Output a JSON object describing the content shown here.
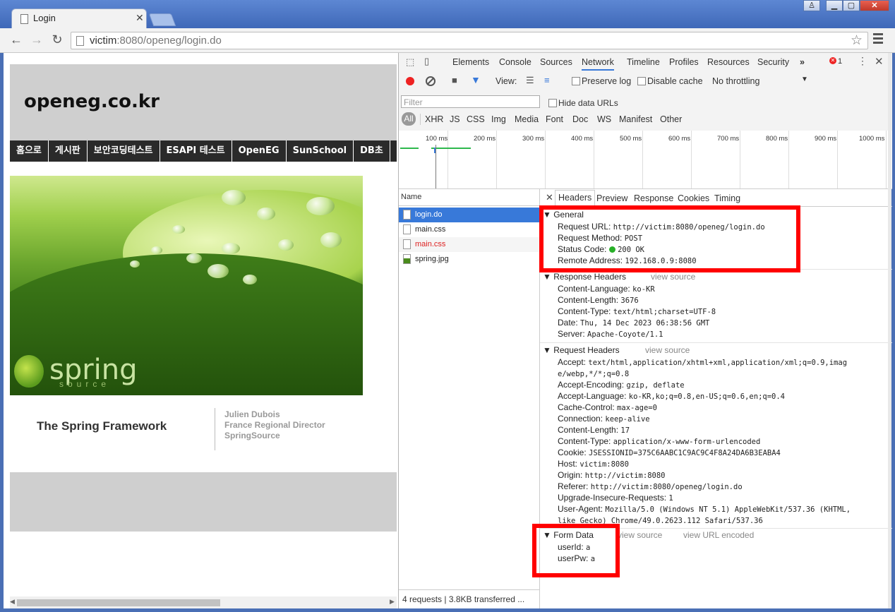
{
  "browser": {
    "tab_title": "Login",
    "url_host": "victim",
    "url_rest": ":8080/openeg/login.do"
  },
  "page": {
    "site_title": "openeg.co.kr",
    "nav": [
      "홈으로",
      "게시판",
      "보안코딩테스트",
      "ESAPI 테스트",
      "OpenEG",
      "SunSchool",
      "DB초"
    ],
    "banner": {
      "logo_word": "spring",
      "logo_sub": "source"
    },
    "credits": {
      "title": "The Spring Framework",
      "name": "Julien Dubois",
      "role": "France Regional Director",
      "org": "SpringSource"
    }
  },
  "devtools": {
    "tabs": [
      "Elements",
      "Console",
      "Sources",
      "Network",
      "Timeline",
      "Profiles",
      "Resources",
      "Security"
    ],
    "more": "»",
    "error_count": "1",
    "toolbar": {
      "view_label": "View:",
      "preserve_log": "Preserve log",
      "disable_cache": "Disable cache",
      "throttling": "No throttling"
    },
    "filter_placeholder": "Filter",
    "hide_data_urls": "Hide data URLs",
    "filter_types": [
      "All",
      "XHR",
      "JS",
      "CSS",
      "Img",
      "Media",
      "Font",
      "Doc",
      "WS",
      "Manifest",
      "Other"
    ],
    "timeline_ticks": [
      "100 ms",
      "200 ms",
      "300 ms",
      "400 ms",
      "500 ms",
      "600 ms",
      "700 ms",
      "800 ms",
      "900 ms",
      "1000 ms"
    ],
    "name_header": "Name",
    "requests": [
      {
        "name": "login.do",
        "selected": true,
        "error": false
      },
      {
        "name": "main.css",
        "selected": false,
        "error": false
      },
      {
        "name": "main.css",
        "selected": false,
        "error": true
      },
      {
        "name": "spring.jpg",
        "selected": false,
        "error": false
      }
    ],
    "summary": "4 requests  |  3.8KB transferred  ...",
    "detail_tabs": [
      "Headers",
      "Preview",
      "Response",
      "Cookies",
      "Timing"
    ],
    "general": {
      "title": "General",
      "rows": [
        {
          "k": "Request URL:",
          "v": "http://victim:8080/openeg/login.do"
        },
        {
          "k": "Request Method:",
          "v": "POST"
        },
        {
          "k": "Status Code:",
          "v": "200 OK"
        },
        {
          "k": "Remote Address:",
          "v": "192.168.0.9:8080"
        }
      ]
    },
    "response_headers": {
      "title": "Response Headers",
      "view_source": "view source",
      "rows": [
        {
          "k": "Content-Language:",
          "v": "ko-KR"
        },
        {
          "k": "Content-Length:",
          "v": "3676"
        },
        {
          "k": "Content-Type:",
          "v": "text/html;charset=UTF-8"
        },
        {
          "k": "Date:",
          "v": "Thu, 14 Dec 2023 06:38:56 GMT"
        },
        {
          "k": "Server:",
          "v": "Apache-Coyote/1.1"
        }
      ]
    },
    "request_headers": {
      "title": "Request Headers",
      "view_source": "view source",
      "rows": [
        {
          "k": "Accept:",
          "v": "text/html,application/xhtml+xml,application/xml;q=0.9,imag"
        },
        {
          "k": "",
          "v": "e/webp,*/*;q=0.8"
        },
        {
          "k": "Accept-Encoding:",
          "v": "gzip, deflate"
        },
        {
          "k": "Accept-Language:",
          "v": "ko-KR,ko;q=0.8,en-US;q=0.6,en;q=0.4"
        },
        {
          "k": "Cache-Control:",
          "v": "max-age=0"
        },
        {
          "k": "Connection:",
          "v": "keep-alive"
        },
        {
          "k": "Content-Length:",
          "v": "17"
        },
        {
          "k": "Content-Type:",
          "v": "application/x-www-form-urlencoded"
        },
        {
          "k": "Cookie:",
          "v": "JSESSIONID=375C6AABC1C9AC9C4F8A24DA6B3EABA4"
        },
        {
          "k": "Host:",
          "v": "victim:8080"
        },
        {
          "k": "Origin:",
          "v": "http://victim:8080"
        },
        {
          "k": "Referer:",
          "v": "http://victim:8080/openeg/login.do"
        },
        {
          "k": "Upgrade-Insecure-Requests:",
          "v": "1"
        },
        {
          "k": "User-Agent:",
          "v": "Mozilla/5.0 (Windows NT 5.1) AppleWebKit/537.36 (KHTML,"
        },
        {
          "k": "",
          "v": "like Gecko) Chrome/49.0.2623.112 Safari/537.36"
        }
      ]
    },
    "form_data": {
      "title": "Form Data",
      "view_source": "view source",
      "view_url_encoded": "view URL encoded",
      "rows": [
        {
          "k": "userId:",
          "v": "a"
        },
        {
          "k": "userPw:",
          "v": "a"
        }
      ]
    },
    "colors": {
      "highlight_box": "#ff0000",
      "selected_row": "#3879d9",
      "status_ok": "#28b028"
    }
  }
}
